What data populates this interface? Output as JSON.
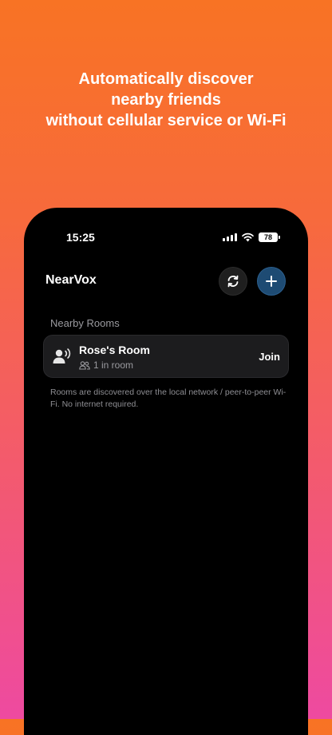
{
  "headline": {
    "line1": "Automatically discover",
    "line2": "nearby friends",
    "line3": "without cellular service or Wi-Fi"
  },
  "status_bar": {
    "time": "15:25",
    "battery": "78"
  },
  "nav": {
    "title": "NearVox"
  },
  "nearby": {
    "section_label": "Nearby Rooms",
    "rooms": [
      {
        "name": "Rose's Room",
        "occupancy": "1 in room",
        "action": "Join"
      }
    ],
    "footnote": "Rooms are discovered over the local network / peer-to-peer Wi-Fi. No internet required."
  },
  "icons": {
    "refresh": "refresh-icon",
    "add": "plus-icon",
    "room": "speaking-person-icon",
    "people": "people-icon"
  },
  "colors": {
    "accent": "#1e4b73",
    "card": "#1c1c1e",
    "secondary_text": "#9a9a9f"
  }
}
